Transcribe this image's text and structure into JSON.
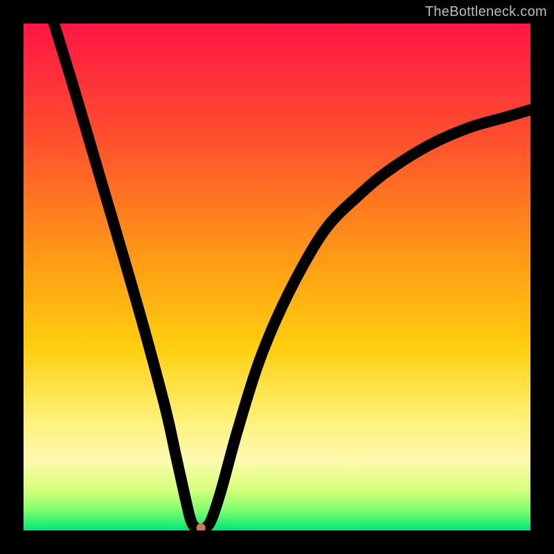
{
  "watermark": "TheBottleneck.com",
  "chart_data": {
    "type": "line",
    "title": "",
    "xlabel": "",
    "ylabel": "",
    "xlim": [
      0,
      100
    ],
    "ylim": [
      0,
      100
    ],
    "grid": false,
    "legend": false,
    "series": [
      {
        "name": "curve",
        "points": [
          {
            "x": 6,
            "y": 100
          },
          {
            "x": 10,
            "y": 87
          },
          {
            "x": 15,
            "y": 70
          },
          {
            "x": 20,
            "y": 53
          },
          {
            "x": 24,
            "y": 39
          },
          {
            "x": 28,
            "y": 24
          },
          {
            "x": 30,
            "y": 15
          },
          {
            "x": 32,
            "y": 6
          },
          {
            "x": 33,
            "y": 2
          },
          {
            "x": 34,
            "y": 0.5
          },
          {
            "x": 35.5,
            "y": 0.3
          },
          {
            "x": 37,
            "y": 2
          },
          {
            "x": 39,
            "y": 8
          },
          {
            "x": 42,
            "y": 19
          },
          {
            "x": 46,
            "y": 32
          },
          {
            "x": 50,
            "y": 42
          },
          {
            "x": 55,
            "y": 52
          },
          {
            "x": 60,
            "y": 60
          },
          {
            "x": 66,
            "y": 66
          },
          {
            "x": 72,
            "y": 71
          },
          {
            "x": 80,
            "y": 76
          },
          {
            "x": 88,
            "y": 79.5
          },
          {
            "x": 95,
            "y": 81.5
          },
          {
            "x": 100,
            "y": 83
          }
        ]
      }
    ],
    "marker": {
      "x": 35,
      "y": 0.5,
      "color": "#c97a5a",
      "r": 0.9
    },
    "background_gradient": {
      "top": "#ff1744",
      "mid": "#ffcf0f",
      "bottom": "#00e676"
    }
  }
}
